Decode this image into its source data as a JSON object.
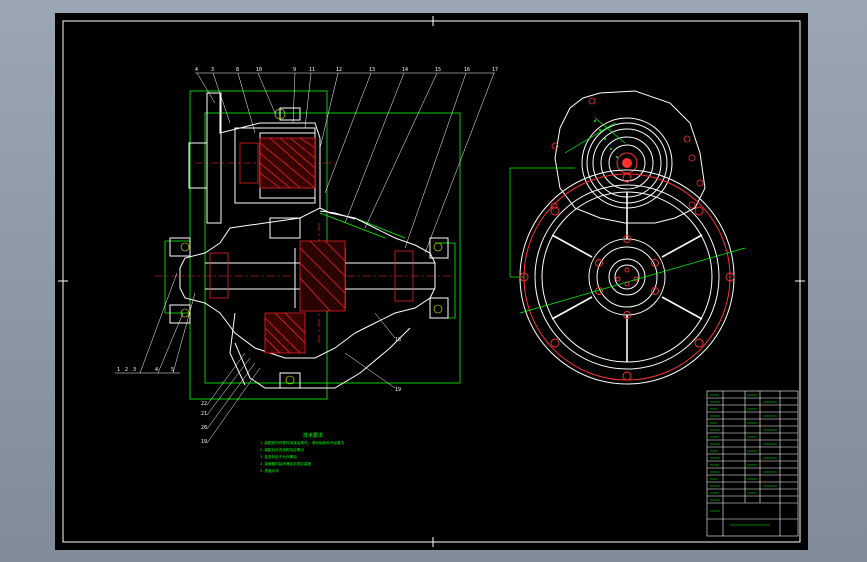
{
  "drawing": {
    "background": "#000000",
    "frame_color": "#ffffff",
    "outline_color": "#ffffff",
    "dimension_color": "#00ff00",
    "section_hatch_color": "#ff0000",
    "centerline_color": "#ff3030",
    "hidden_color": "#ffff00"
  },
  "section_view": {
    "part_labels_top": [
      "4",
      "3",
      "8",
      "10",
      "9",
      "11",
      "12",
      "13",
      "14",
      "15",
      "16",
      "17"
    ],
    "part_labels_left": [
      "1",
      "2",
      "3",
      "4",
      "5"
    ],
    "part_labels_bottom_left": [
      "22",
      "21",
      "20",
      "19"
    ],
    "part_labels_right": [
      "18",
      "19"
    ]
  },
  "notes": {
    "title": "技术要求",
    "lines": [
      "1.装配前所有零件用煤油清洗, 滚动轴承用汽油清洗",
      "2.装配后检查齿轮啮合情况",
      "3.各密封处不允许漏油",
      "4.减速器内装润滑油至规定高度",
      "5.表面涂漆"
    ]
  },
  "title_block": {
    "rows": 16
  }
}
